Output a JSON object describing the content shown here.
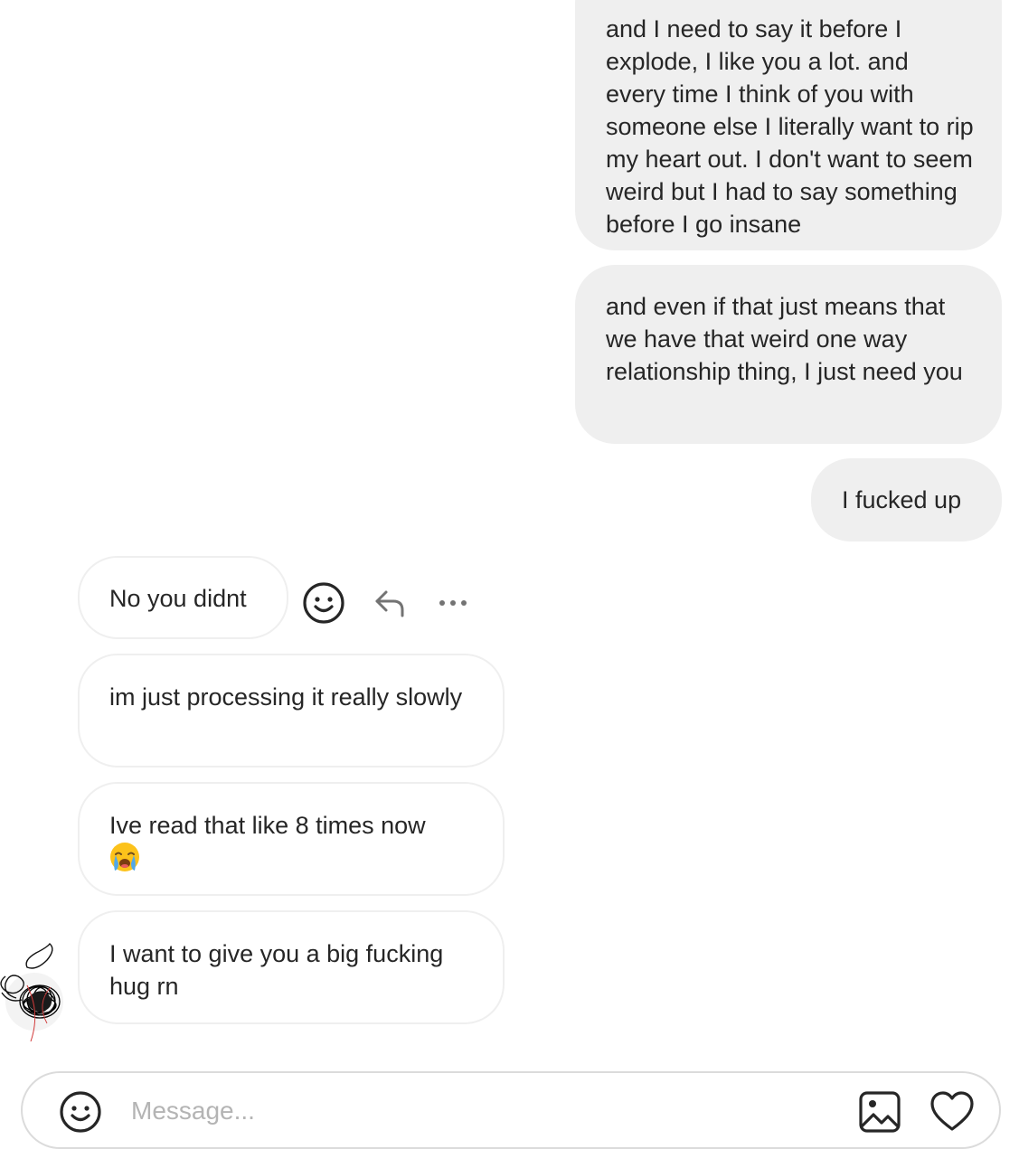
{
  "messages": [
    {
      "direction": "sent",
      "text": "and I need to say it before I explode, I like you a lot. and every time I think of you with someone else I literally want to rip my heart out. I don't want to seem weird but I had to say something before I go insane"
    },
    {
      "direction": "sent",
      "text": "and even if that just means that we have that weird one way relationship thing, I just need you"
    },
    {
      "direction": "sent",
      "text": "I fucked up"
    },
    {
      "direction": "received",
      "text": "No you didnt"
    },
    {
      "direction": "received",
      "text": "im just processing it really slowly"
    },
    {
      "direction": "received",
      "text": "Ive read that like 8 times now",
      "emoji": "loudly-crying-face-emoji"
    },
    {
      "direction": "received",
      "text": "I want to give you a big fucking hug rn"
    }
  ],
  "message_actions": {
    "icons": [
      "emoji-react-icon",
      "reply-icon",
      "more-options-icon"
    ]
  },
  "composer": {
    "placeholder": "Message...",
    "icons": [
      "emoji-icon",
      "image-icon",
      "heart-icon"
    ]
  },
  "colors": {
    "sent_bubble": "#efefef",
    "received_border": "#efefef",
    "text": "#262626",
    "placeholder": "#b4b4b4",
    "composer_border": "#dbdbdb"
  }
}
